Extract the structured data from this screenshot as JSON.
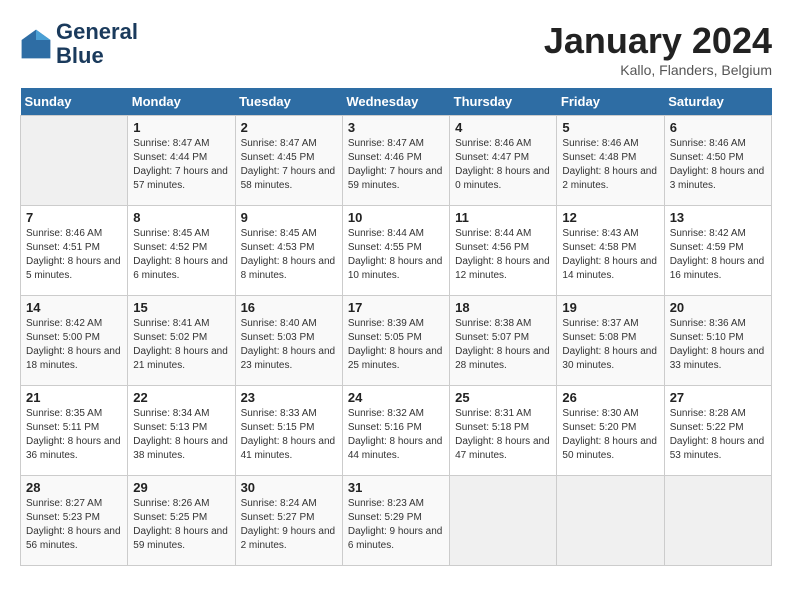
{
  "header": {
    "logo_line1": "General",
    "logo_line2": "Blue",
    "month_title": "January 2024",
    "location": "Kallo, Flanders, Belgium"
  },
  "weekdays": [
    "Sunday",
    "Monday",
    "Tuesday",
    "Wednesday",
    "Thursday",
    "Friday",
    "Saturday"
  ],
  "weeks": [
    [
      {
        "day": "",
        "sunrise": "",
        "sunset": "",
        "daylight": ""
      },
      {
        "day": "1",
        "sunrise": "Sunrise: 8:47 AM",
        "sunset": "Sunset: 4:44 PM",
        "daylight": "Daylight: 7 hours and 57 minutes."
      },
      {
        "day": "2",
        "sunrise": "Sunrise: 8:47 AM",
        "sunset": "Sunset: 4:45 PM",
        "daylight": "Daylight: 7 hours and 58 minutes."
      },
      {
        "day": "3",
        "sunrise": "Sunrise: 8:47 AM",
        "sunset": "Sunset: 4:46 PM",
        "daylight": "Daylight: 7 hours and 59 minutes."
      },
      {
        "day": "4",
        "sunrise": "Sunrise: 8:46 AM",
        "sunset": "Sunset: 4:47 PM",
        "daylight": "Daylight: 8 hours and 0 minutes."
      },
      {
        "day": "5",
        "sunrise": "Sunrise: 8:46 AM",
        "sunset": "Sunset: 4:48 PM",
        "daylight": "Daylight: 8 hours and 2 minutes."
      },
      {
        "day": "6",
        "sunrise": "Sunrise: 8:46 AM",
        "sunset": "Sunset: 4:50 PM",
        "daylight": "Daylight: 8 hours and 3 minutes."
      }
    ],
    [
      {
        "day": "7",
        "sunrise": "Sunrise: 8:46 AM",
        "sunset": "Sunset: 4:51 PM",
        "daylight": "Daylight: 8 hours and 5 minutes."
      },
      {
        "day": "8",
        "sunrise": "Sunrise: 8:45 AM",
        "sunset": "Sunset: 4:52 PM",
        "daylight": "Daylight: 8 hours and 6 minutes."
      },
      {
        "day": "9",
        "sunrise": "Sunrise: 8:45 AM",
        "sunset": "Sunset: 4:53 PM",
        "daylight": "Daylight: 8 hours and 8 minutes."
      },
      {
        "day": "10",
        "sunrise": "Sunrise: 8:44 AM",
        "sunset": "Sunset: 4:55 PM",
        "daylight": "Daylight: 8 hours and 10 minutes."
      },
      {
        "day": "11",
        "sunrise": "Sunrise: 8:44 AM",
        "sunset": "Sunset: 4:56 PM",
        "daylight": "Daylight: 8 hours and 12 minutes."
      },
      {
        "day": "12",
        "sunrise": "Sunrise: 8:43 AM",
        "sunset": "Sunset: 4:58 PM",
        "daylight": "Daylight: 8 hours and 14 minutes."
      },
      {
        "day": "13",
        "sunrise": "Sunrise: 8:42 AM",
        "sunset": "Sunset: 4:59 PM",
        "daylight": "Daylight: 8 hours and 16 minutes."
      }
    ],
    [
      {
        "day": "14",
        "sunrise": "Sunrise: 8:42 AM",
        "sunset": "Sunset: 5:00 PM",
        "daylight": "Daylight: 8 hours and 18 minutes."
      },
      {
        "day": "15",
        "sunrise": "Sunrise: 8:41 AM",
        "sunset": "Sunset: 5:02 PM",
        "daylight": "Daylight: 8 hours and 21 minutes."
      },
      {
        "day": "16",
        "sunrise": "Sunrise: 8:40 AM",
        "sunset": "Sunset: 5:03 PM",
        "daylight": "Daylight: 8 hours and 23 minutes."
      },
      {
        "day": "17",
        "sunrise": "Sunrise: 8:39 AM",
        "sunset": "Sunset: 5:05 PM",
        "daylight": "Daylight: 8 hours and 25 minutes."
      },
      {
        "day": "18",
        "sunrise": "Sunrise: 8:38 AM",
        "sunset": "Sunset: 5:07 PM",
        "daylight": "Daylight: 8 hours and 28 minutes."
      },
      {
        "day": "19",
        "sunrise": "Sunrise: 8:37 AM",
        "sunset": "Sunset: 5:08 PM",
        "daylight": "Daylight: 8 hours and 30 minutes."
      },
      {
        "day": "20",
        "sunrise": "Sunrise: 8:36 AM",
        "sunset": "Sunset: 5:10 PM",
        "daylight": "Daylight: 8 hours and 33 minutes."
      }
    ],
    [
      {
        "day": "21",
        "sunrise": "Sunrise: 8:35 AM",
        "sunset": "Sunset: 5:11 PM",
        "daylight": "Daylight: 8 hours and 36 minutes."
      },
      {
        "day": "22",
        "sunrise": "Sunrise: 8:34 AM",
        "sunset": "Sunset: 5:13 PM",
        "daylight": "Daylight: 8 hours and 38 minutes."
      },
      {
        "day": "23",
        "sunrise": "Sunrise: 8:33 AM",
        "sunset": "Sunset: 5:15 PM",
        "daylight": "Daylight: 8 hours and 41 minutes."
      },
      {
        "day": "24",
        "sunrise": "Sunrise: 8:32 AM",
        "sunset": "Sunset: 5:16 PM",
        "daylight": "Daylight: 8 hours and 44 minutes."
      },
      {
        "day": "25",
        "sunrise": "Sunrise: 8:31 AM",
        "sunset": "Sunset: 5:18 PM",
        "daylight": "Daylight: 8 hours and 47 minutes."
      },
      {
        "day": "26",
        "sunrise": "Sunrise: 8:30 AM",
        "sunset": "Sunset: 5:20 PM",
        "daylight": "Daylight: 8 hours and 50 minutes."
      },
      {
        "day": "27",
        "sunrise": "Sunrise: 8:28 AM",
        "sunset": "Sunset: 5:22 PM",
        "daylight": "Daylight: 8 hours and 53 minutes."
      }
    ],
    [
      {
        "day": "28",
        "sunrise": "Sunrise: 8:27 AM",
        "sunset": "Sunset: 5:23 PM",
        "daylight": "Daylight: 8 hours and 56 minutes."
      },
      {
        "day": "29",
        "sunrise": "Sunrise: 8:26 AM",
        "sunset": "Sunset: 5:25 PM",
        "daylight": "Daylight: 8 hours and 59 minutes."
      },
      {
        "day": "30",
        "sunrise": "Sunrise: 8:24 AM",
        "sunset": "Sunset: 5:27 PM",
        "daylight": "Daylight: 9 hours and 2 minutes."
      },
      {
        "day": "31",
        "sunrise": "Sunrise: 8:23 AM",
        "sunset": "Sunset: 5:29 PM",
        "daylight": "Daylight: 9 hours and 6 minutes."
      },
      {
        "day": "",
        "sunrise": "",
        "sunset": "",
        "daylight": ""
      },
      {
        "day": "",
        "sunrise": "",
        "sunset": "",
        "daylight": ""
      },
      {
        "day": "",
        "sunrise": "",
        "sunset": "",
        "daylight": ""
      }
    ]
  ]
}
